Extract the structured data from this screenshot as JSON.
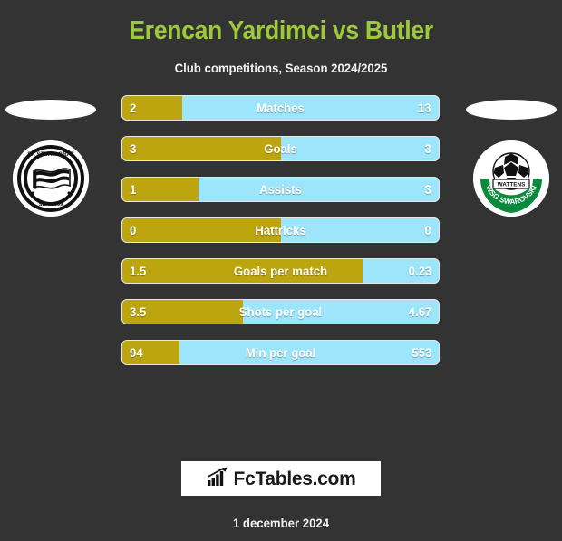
{
  "header": {
    "title": "Erencan Yardimci vs Butler",
    "subtitle": "Club competitions, Season 2024/2025",
    "title_color": "#9dc83b"
  },
  "colors": {
    "background": "#333333",
    "home_bar": "#bda50f",
    "away_bar": "#9de5fb",
    "text": "#ffffff"
  },
  "crests": {
    "home": {
      "name": "sk-sturm-graz-crest",
      "top_text": "SK STURM GRAZ",
      "bottom_text": "SEIT 1909"
    },
    "away": {
      "name": "wsg-swarovski-wattens-crest",
      "arc_text": "WSG SWAROVSKI",
      "badge_text": "WATTENS"
    }
  },
  "chart_data": {
    "type": "bar",
    "title": "Erencan Yardimci vs Butler",
    "subtitle": "Club competitions, Season 2024/2025",
    "orientation": "horizontal-diverging",
    "categories": [
      "Matches",
      "Goals",
      "Assists",
      "Hattricks",
      "Goals per match",
      "Shots per goal",
      "Min per goal"
    ],
    "series": [
      {
        "name": "Erencan Yardimci",
        "color": "#bda50f",
        "values": [
          "2",
          "3",
          "1",
          "0",
          "1.5",
          "3.5",
          "94"
        ]
      },
      {
        "name": "Butler",
        "color": "#9de5fb",
        "values": [
          "13",
          "3",
          "3",
          "0",
          "0.23",
          "4.67",
          "553"
        ]
      }
    ],
    "fill_percents": [
      19,
      50,
      24,
      50,
      76,
      38,
      18
    ]
  },
  "rows": [
    {
      "label": "Matches",
      "home": "2",
      "away": "13",
      "fill": 19
    },
    {
      "label": "Goals",
      "home": "3",
      "away": "3",
      "fill": 50
    },
    {
      "label": "Assists",
      "home": "1",
      "away": "3",
      "fill": 24
    },
    {
      "label": "Hattricks",
      "home": "0",
      "away": "0",
      "fill": 50
    },
    {
      "label": "Goals per match",
      "home": "1.5",
      "away": "0.23",
      "fill": 76
    },
    {
      "label": "Shots per goal",
      "home": "3.5",
      "away": "4.67",
      "fill": 38
    },
    {
      "label": "Min per goal",
      "home": "94",
      "away": "553",
      "fill": 18
    }
  ],
  "footer": {
    "brand": "FcTables.com",
    "brand_icon": "bar-chart-growth-icon",
    "date": "1 december 2024"
  }
}
